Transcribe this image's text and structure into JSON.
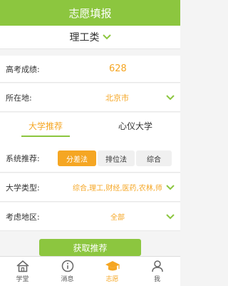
{
  "header": {
    "title": "志愿填报"
  },
  "category": {
    "label": "理工类"
  },
  "score": {
    "label": "高考成绩:",
    "value": "628"
  },
  "location": {
    "label": "所在地:",
    "value": "北京市"
  },
  "tabs": [
    {
      "label": "大学推荐"
    },
    {
      "label": "心仪大学"
    }
  ],
  "system": {
    "label": "系统推荐:",
    "options": [
      {
        "label": "分差法"
      },
      {
        "label": "排位法"
      },
      {
        "label": "综合"
      }
    ]
  },
  "univ_type": {
    "label": "大学类型:",
    "value": "综合,理工,财经,医药,农林,师范"
  },
  "region": {
    "label": "考虑地区:",
    "value": "全部"
  },
  "submit": {
    "label": "获取推荐"
  },
  "tabbar": [
    {
      "label": "学堂"
    },
    {
      "label": "消息"
    },
    {
      "label": "志愿"
    },
    {
      "label": "我"
    }
  ],
  "colors": {
    "primary": "#8cc63f",
    "accent": "#f5a623"
  }
}
